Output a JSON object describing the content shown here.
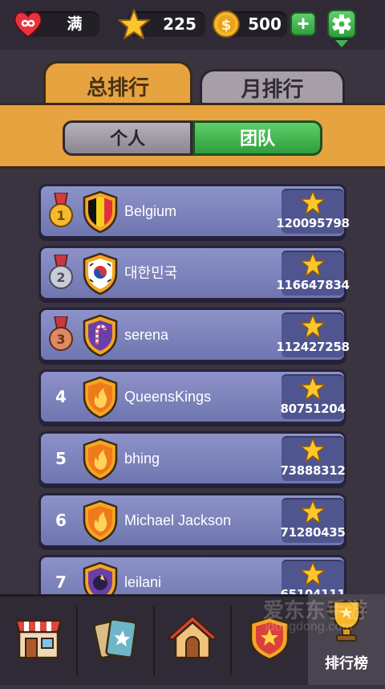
{
  "hud": {
    "lives_label": "满",
    "stars": "225",
    "coins": "500",
    "add_label": "+"
  },
  "tabs": [
    {
      "label": "总排行",
      "active": true
    },
    {
      "label": "月排行",
      "active": false
    }
  ],
  "segments": [
    {
      "label": "个人",
      "active": false
    },
    {
      "label": "团队",
      "active": true
    }
  ],
  "leaderboard": [
    {
      "rank": "1",
      "medal": "gold",
      "emblem": "belgium-flag-shield",
      "name": "Belgium",
      "score": "120095798"
    },
    {
      "rank": "2",
      "medal": "silver",
      "emblem": "korea-flag-shield",
      "name": "대한민국",
      "score": "116647834"
    },
    {
      "rank": "3",
      "medal": "bronze",
      "emblem": "purple-shield",
      "name": "serena",
      "score": "112427258"
    },
    {
      "rank": "4",
      "medal": "",
      "emblem": "fire-shield",
      "name": "QueensKings",
      "score": "80751204"
    },
    {
      "rank": "5",
      "medal": "",
      "emblem": "fire-shield",
      "name": "bhing",
      "score": "73888312"
    },
    {
      "rank": "6",
      "medal": "",
      "emblem": "fire-shield",
      "name": "Michael Jackson",
      "score": "71280435"
    },
    {
      "rank": "7",
      "medal": "",
      "emblem": "unicorn-shield",
      "name": "leilani",
      "score": "65104111"
    }
  ],
  "nav": {
    "items": [
      "shop-icon",
      "cards-icon",
      "home-icon",
      "team-shield-icon",
      "trophy-icon"
    ],
    "active_label": "排行榜"
  },
  "watermark": {
    "line1": "爱东东手游",
    "line2": "idongdong.com"
  },
  "colors": {
    "accent_orange": "#e6a33f",
    "active_green": "#3fb44f",
    "row_blue": "#7f85bd",
    "background": "#3a3441"
  }
}
